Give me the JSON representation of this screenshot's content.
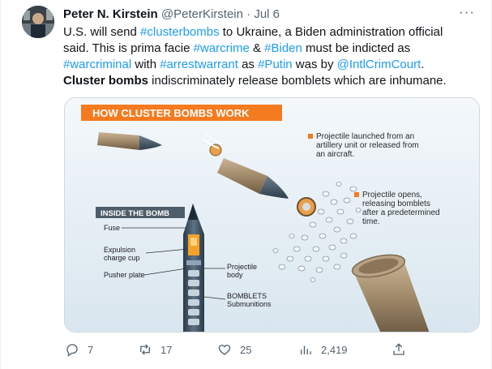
{
  "tweet": {
    "author_name": "Peter N. Kirstein",
    "author_handle": "@PeterKirstein",
    "separator": "·",
    "date": "Jul 6",
    "more_label": "···",
    "body": {
      "line1_a": "U.S. will send ",
      "tag_clusterbombs": "#clusterbombs",
      "line1_b": " to Ukraine, a Biden administration official",
      "line2_a": "said. This is prima facie ",
      "tag_warcrime": "#warcrime",
      "amp": " & ",
      "tag_biden": "#Biden",
      "line2_b": " must be indicted as",
      "tag_warcriminal": "#warcriminal",
      "with": " with ",
      "tag_arrestwarrant": "#arrestwarrant",
      "as": " as ",
      "tag_putin": "#Putin",
      "was_by": " was by ",
      "tag_icc": "@IntlCrimCourt",
      "period": ".",
      "bold_lead": "Cluster bombs",
      "line4_rest": " indiscriminately release bomblets which are inhumane."
    }
  },
  "infographic": {
    "banner": "HOW CLUSTER BOMBS WORK",
    "step1": [
      "Projectile launched from an",
      "artillery unit or released from",
      "an aircraft."
    ],
    "step2": [
      "Projectile opens,",
      "releasing bomblets",
      "after a predetermined",
      "time."
    ],
    "inside_title": "INSIDE THE BOMB",
    "labels": {
      "fuse": "Fuse",
      "expulsion": [
        "Expulsion",
        "charge cup"
      ],
      "pusher": "Pusher plate",
      "projectile_body": [
        "Projectile",
        "body"
      ],
      "bomblets": [
        "BOMBLETS",
        "Submunitions"
      ]
    },
    "colors": {
      "banner": "#f47b20",
      "shell": "#a08a6a",
      "bullet_marker": "#f47b20"
    }
  },
  "actions": {
    "reply": {
      "icon": "reply-icon",
      "count": "7"
    },
    "retweet": {
      "icon": "retweet-icon",
      "count": "17"
    },
    "like": {
      "icon": "heart-icon",
      "count": "25"
    },
    "views": {
      "icon": "views-icon",
      "count": "2,419"
    },
    "share": {
      "icon": "share-icon"
    }
  }
}
